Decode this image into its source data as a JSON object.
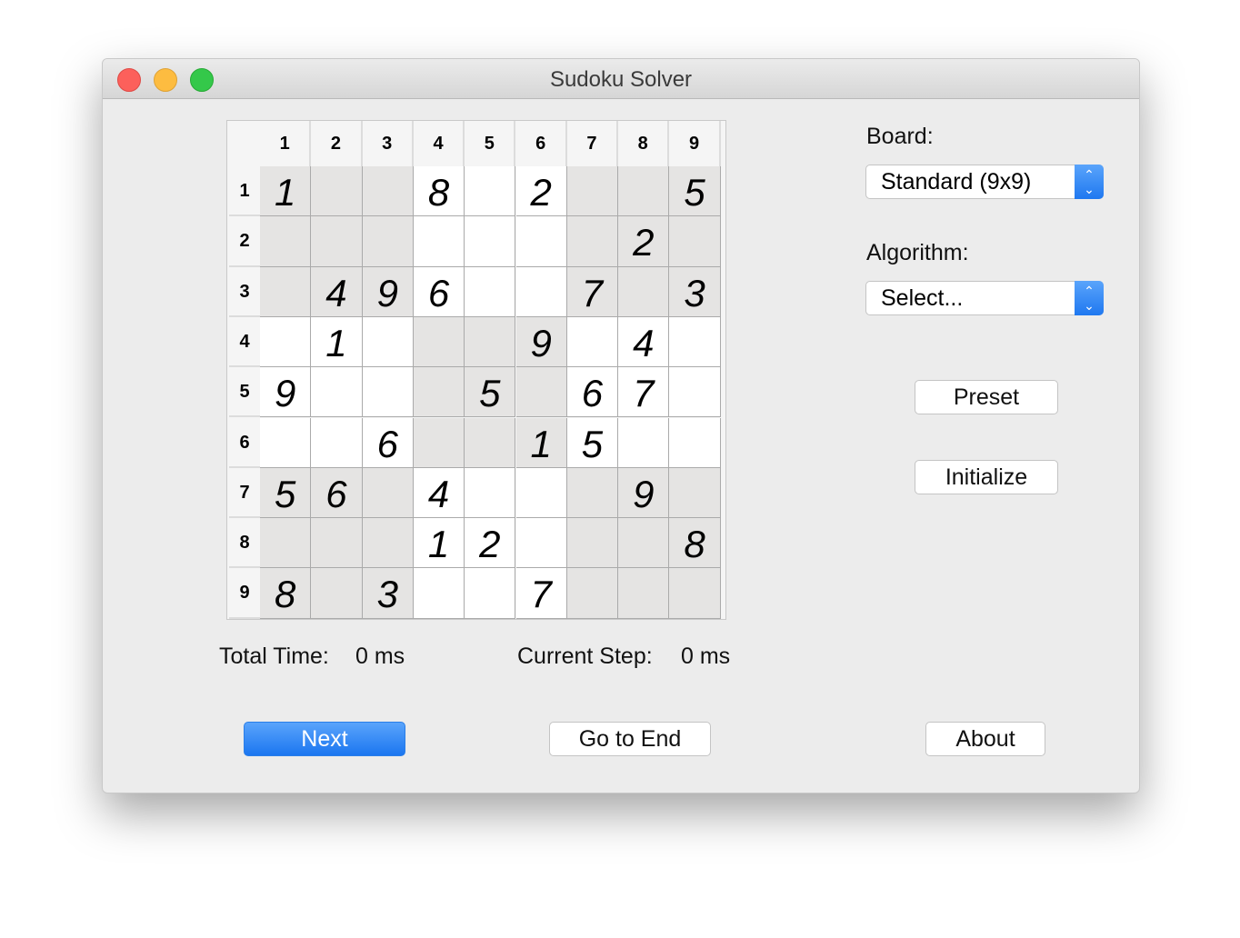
{
  "window": {
    "title": "Sudoku Solver"
  },
  "grid": {
    "col_headers": [
      "1",
      "2",
      "3",
      "4",
      "5",
      "6",
      "7",
      "8",
      "9"
    ],
    "row_headers": [
      "1",
      "2",
      "3",
      "4",
      "5",
      "6",
      "7",
      "8",
      "9"
    ],
    "cells": [
      [
        "1",
        "",
        "",
        "8",
        "",
        "2",
        "",
        "",
        "5"
      ],
      [
        "",
        "",
        "",
        "",
        "",
        "",
        "",
        "2",
        ""
      ],
      [
        "",
        "4",
        "9",
        "6",
        "",
        "",
        "7",
        "",
        "3"
      ],
      [
        "",
        "1",
        "",
        "",
        "",
        "9",
        "",
        "4",
        ""
      ],
      [
        "9",
        "",
        "",
        "",
        "5",
        "",
        "6",
        "7",
        ""
      ],
      [
        "",
        "",
        "6",
        "",
        "",
        "1",
        "5",
        "",
        ""
      ],
      [
        "5",
        "6",
        "",
        "4",
        "",
        "",
        "",
        "9",
        ""
      ],
      [
        "",
        "",
        "",
        "1",
        "2",
        "",
        "",
        "",
        "8"
      ],
      [
        "8",
        "",
        "3",
        "",
        "",
        "7",
        "",
        "",
        ""
      ]
    ]
  },
  "status": {
    "total_time_label": "Total Time:",
    "total_time_value": "0 ms",
    "current_step_label": "Current Step:",
    "current_step_value": "0 ms"
  },
  "sidebar": {
    "board_label": "Board:",
    "board_value": "Standard (9x9)",
    "algorithm_label": "Algorithm:",
    "algorithm_value": "Select...",
    "preset": "Preset",
    "initialize": "Initialize"
  },
  "buttons": {
    "next": "Next",
    "go_to_end": "Go to End",
    "about": "About"
  },
  "colors": {
    "accent": "#1f78f0",
    "shaded_cell": "#e5e4e3"
  }
}
